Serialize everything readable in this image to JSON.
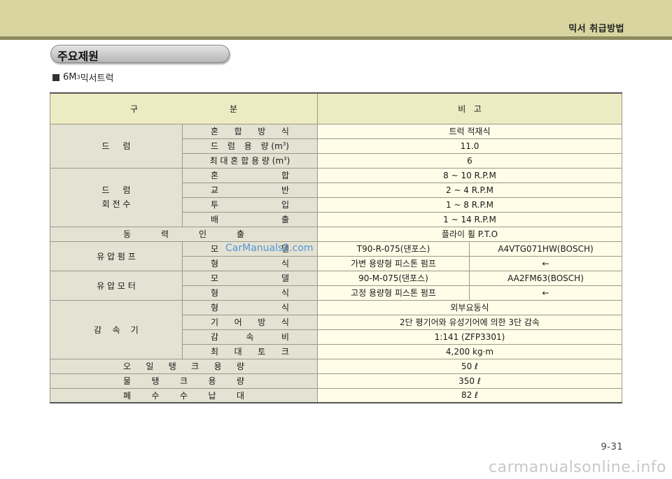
{
  "header": {
    "title": "믹서 취급방법"
  },
  "section": {
    "title": "주요제원"
  },
  "subheading": {
    "prefix": "6M",
    "sup": "3",
    "suffix": " 믹서트럭"
  },
  "table": {
    "head": {
      "col1": "구",
      "col2": "분",
      "col3": "비   고"
    },
    "drum": {
      "label": "드     럼",
      "rows": [
        {
          "label": [
            "혼",
            "합",
            "방",
            "식"
          ],
          "value": "트럭 적재식"
        },
        {
          "label": [
            "드",
            "럼",
            "용",
            "량 (m"
          ],
          "unit_sup": "3",
          "unit_end": ")",
          "value": "11.0"
        },
        {
          "label": [
            "최 대 혼 합 용 량 (m"
          ],
          "unit_sup": "3",
          "unit_end": ")",
          "value": "6"
        }
      ]
    },
    "rpm": {
      "label1": "드     럼",
      "label2": "회 전 수",
      "rows": [
        {
          "label": [
            "혼",
            "합"
          ],
          "value": "8 ~ 10 R.P.M"
        },
        {
          "label": [
            "교",
            "반"
          ],
          "value": "2 ~ 4 R.P.M"
        },
        {
          "label": [
            "투",
            "입"
          ],
          "value": "1 ~ 8 R.P.M"
        },
        {
          "label": [
            "배",
            "출"
          ],
          "value": "1 ~ 14 R.P.M"
        }
      ]
    },
    "power": {
      "label": [
        "동",
        "력",
        "인",
        "출"
      ],
      "value": "플라이 휠 P.T.O"
    },
    "pump": {
      "label": "유 압 펌 프",
      "rows": [
        {
          "label": [
            "모",
            "델"
          ],
          "value1": "T90-R-075(댄포스)",
          "value2": "A4VTG071HW(BOSCH)"
        },
        {
          "label": [
            "형",
            "식"
          ],
          "value1": "가변 용량형 피스톤 펌프",
          "value2": "←"
        }
      ]
    },
    "motor": {
      "label": "유 압 모 터",
      "rows": [
        {
          "label": [
            "모",
            "델"
          ],
          "value1": "90-M-075(댄포스)",
          "value2": "AA2FM63(BOSCH)"
        },
        {
          "label": [
            "형",
            "식"
          ],
          "value1": "고정 용량형 피스톤 펌프",
          "value2": "←"
        }
      ]
    },
    "reducer": {
      "label": "감    속    기",
      "rows": [
        {
          "label": [
            "형",
            "식"
          ],
          "value": "외부요동식"
        },
        {
          "label": [
            "기",
            "어",
            "방",
            "식"
          ],
          "value": "2단 평기어와 유성기어에 의한 3단 감속"
        },
        {
          "label": [
            "감",
            "속",
            "비"
          ],
          "value": "1:141 (ZFP3301)"
        },
        {
          "label": [
            "최",
            "대",
            "토",
            "크"
          ],
          "value": "4,200 kg·m"
        }
      ]
    },
    "oil": {
      "label": [
        "오",
        "일",
        "탱",
        "크",
        "용",
        "량"
      ],
      "value": "50 ℓ"
    },
    "water": {
      "label": [
        "물",
        "탱",
        "크",
        "용",
        "량"
      ],
      "value": "350 ℓ"
    },
    "waste": {
      "label": [
        "폐",
        "수",
        "수",
        "납",
        "대"
      ],
      "value": "82 ℓ"
    }
  },
  "watermarks": {
    "center": "CarManuals2.com",
    "bottom": "carmanualsonline.info"
  },
  "page": {
    "number": "9-31"
  }
}
